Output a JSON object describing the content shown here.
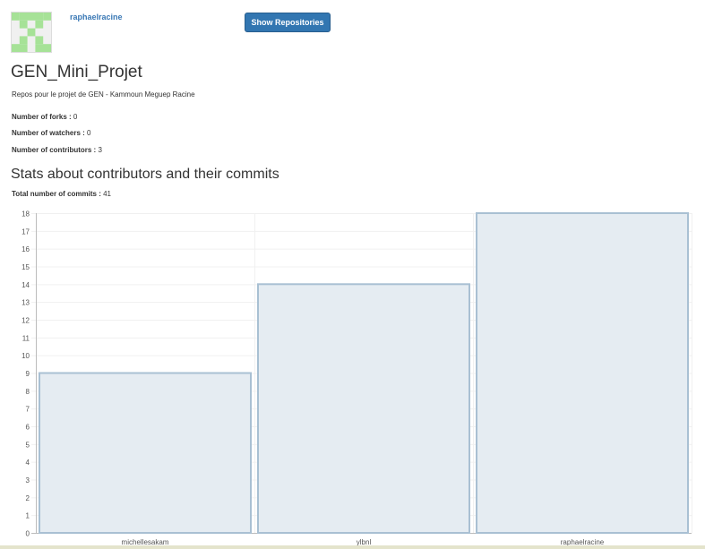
{
  "user": {
    "username": "raphaelracine",
    "avatar_icon": "identicon-icon"
  },
  "header": {
    "show_button_label": "Show Repositories"
  },
  "repo": {
    "title": "GEN_Mini_Projet",
    "description": "Repos pour le projet de GEN - Kammoun Meguep Racine",
    "forks_label": "Number of forks :",
    "forks_value": "0",
    "watchers_label": "Number of watchers :",
    "watchers_value": "0",
    "contributors_label": "Number of contributors :",
    "contributors_value": "3"
  },
  "stats": {
    "title": "Stats about contributors and their commits",
    "total_label": "Total number of commits :",
    "total_value": "41"
  },
  "chart_data": {
    "type": "bar",
    "categories": [
      "michellesakam",
      "ylbnl",
      "raphaelracine"
    ],
    "values": [
      9,
      14,
      18
    ],
    "title": "",
    "xlabel": "",
    "ylabel": "",
    "ylim": [
      0,
      18
    ],
    "yticks": [
      0,
      1,
      2,
      3,
      4,
      5,
      6,
      7,
      8,
      9,
      10,
      11,
      12,
      13,
      14,
      15,
      16,
      17,
      18
    ],
    "grid": true,
    "bar_fill": "#e5ecf2",
    "bar_stroke": "#a9c0d3"
  }
}
